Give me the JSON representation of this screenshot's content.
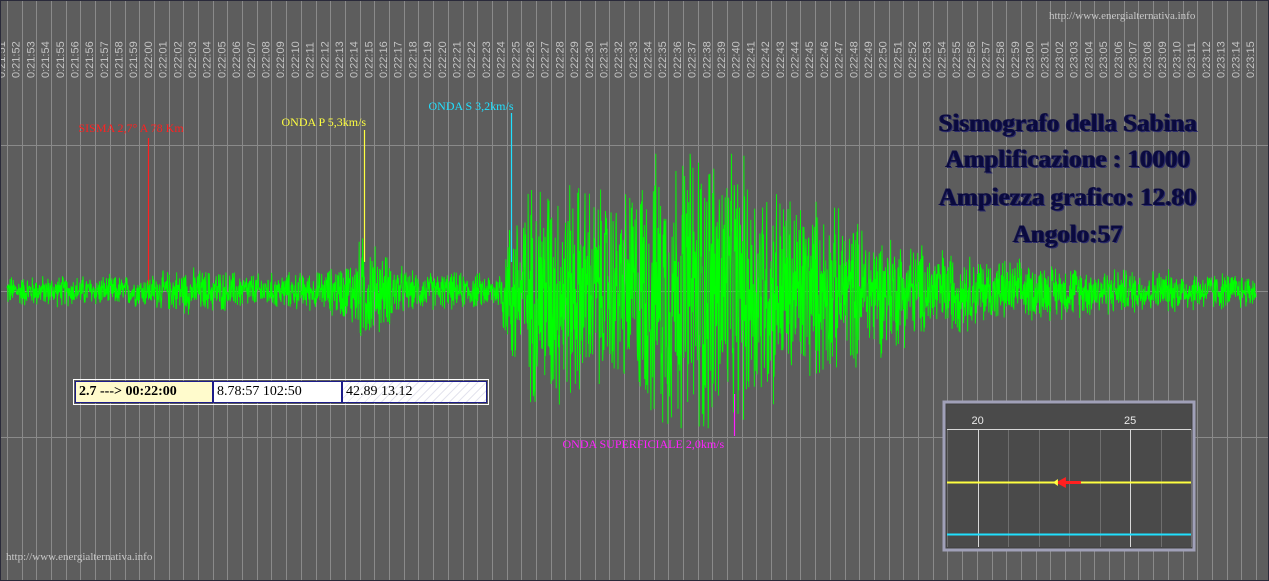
{
  "header": {
    "watermark_top": "http://www.energialternativa.info",
    "watermark_bottom": "http://www.energialternativa.info"
  },
  "title_block": {
    "line1": "Sismografo della Sabina",
    "line2": "Amplificazione : 10000",
    "line3": "Ampiezza grafico: 12.80",
    "line4": "Angolo:57"
  },
  "info_boxes": {
    "event": "2.7 ---> 00:22:00",
    "distance_time": "8.78:57 102:50",
    "coordinates": "42.89 13.12"
  },
  "colors": {
    "background": "#5d5d5d",
    "grid": "#8a8a8a",
    "signal": "#00ff00",
    "event_marker": "#ff2020",
    "p_wave": "#ffff40",
    "s_wave": "#20e0ff",
    "surface_wave": "#ff20ff"
  },
  "chart_data": {
    "type": "line",
    "x_tick_labels": [
      "0:21:51",
      "0:21:52",
      "0:21:53",
      "0:21:54",
      "0:21:55",
      "0:21:56",
      "0:21:56",
      "0:21:57",
      "0:21:58",
      "0:21:59",
      "0:22:00",
      "0:22:01",
      "0:22:02",
      "0:22:03",
      "0:22:04",
      "0:22:05",
      "0:22:06",
      "0:22:07",
      "0:22:08",
      "0:22:09",
      "0:22:10",
      "0:22:11",
      "0:22:12",
      "0:22:13",
      "0:22:14",
      "0:22:15",
      "0:22:16",
      "0:22:17",
      "0:22:18",
      "0:22:19",
      "0:22:20",
      "0:22:21",
      "0:22:22",
      "0:22:23",
      "0:22:24",
      "0:22:25",
      "0:22:26",
      "0:22:27",
      "0:22:28",
      "0:22:29",
      "0:22:30",
      "0:22:31",
      "0:22:32",
      "0:22:33",
      "0:22:34",
      "0:22:35",
      "0:22:36",
      "0:22:37",
      "0:22:38",
      "0:22:39",
      "0:22:40",
      "0:22:41",
      "0:22:42",
      "0:22:43",
      "0:22:44",
      "0:22:45",
      "0:22:46",
      "0:22:47",
      "0:22:48",
      "0:22:49",
      "0:22:50",
      "0:22:51",
      "0:22:52",
      "0:22:53",
      "0:22:54",
      "0:22:55",
      "0:22:56",
      "0:22:57",
      "0:22:58",
      "0:22:59",
      "0:23:00",
      "0:23:01",
      "0:23:02",
      "0:23:03",
      "0:23:04",
      "0:23:05",
      "0:23:06",
      "0:23:07",
      "0:23:08",
      "0:23:09",
      "0:23:10",
      "0:23:11",
      "0:23:12",
      "0:23:13",
      "0:23:14",
      "0:23:15"
    ],
    "x_range_seconds": [
      1311,
      1395
    ],
    "y_range": [
      -1,
      1
    ],
    "grid": true,
    "envelope": [
      {
        "t": 1311,
        "a": 0.08
      },
      {
        "t": 1320,
        "a": 0.08
      },
      {
        "t": 1323,
        "a": 0.12
      },
      {
        "t": 1328,
        "a": 0.09
      },
      {
        "t": 1332,
        "a": 0.1
      },
      {
        "t": 1334,
        "a": 0.16
      },
      {
        "t": 1335,
        "a": 0.3
      },
      {
        "t": 1336,
        "a": 0.22
      },
      {
        "t": 1338,
        "a": 0.1
      },
      {
        "t": 1344,
        "a": 0.09
      },
      {
        "t": 1345,
        "a": 0.45
      },
      {
        "t": 1347,
        "a": 0.62
      },
      {
        "t": 1350,
        "a": 0.55
      },
      {
        "t": 1352,
        "a": 0.48
      },
      {
        "t": 1355,
        "a": 0.72
      },
      {
        "t": 1358,
        "a": 0.8
      },
      {
        "t": 1360,
        "a": 0.7
      },
      {
        "t": 1363,
        "a": 0.55
      },
      {
        "t": 1367,
        "a": 0.4
      },
      {
        "t": 1372,
        "a": 0.25
      },
      {
        "t": 1378,
        "a": 0.16
      },
      {
        "t": 1385,
        "a": 0.12
      },
      {
        "t": 1395,
        "a": 0.09
      }
    ],
    "annotations": [
      {
        "label": "SISMA 2,7° A 78 Km",
        "t": 1320.5,
        "type": "event_marker"
      },
      {
        "label": "ONDA P 5,3km/s",
        "t": 1335,
        "type": "p_wave"
      },
      {
        "label": "ONDA S 3,2km/s",
        "t": 1344.9,
        "type": "s_wave"
      },
      {
        "label": "ONDA SUPERFICIALE 2,0km/s",
        "t": 1359.9,
        "type": "surface_wave"
      }
    ],
    "inset": {
      "tick_labels": [
        "20",
        "25"
      ],
      "x_range": [
        19,
        27
      ],
      "marker_position": 22.8
    }
  }
}
